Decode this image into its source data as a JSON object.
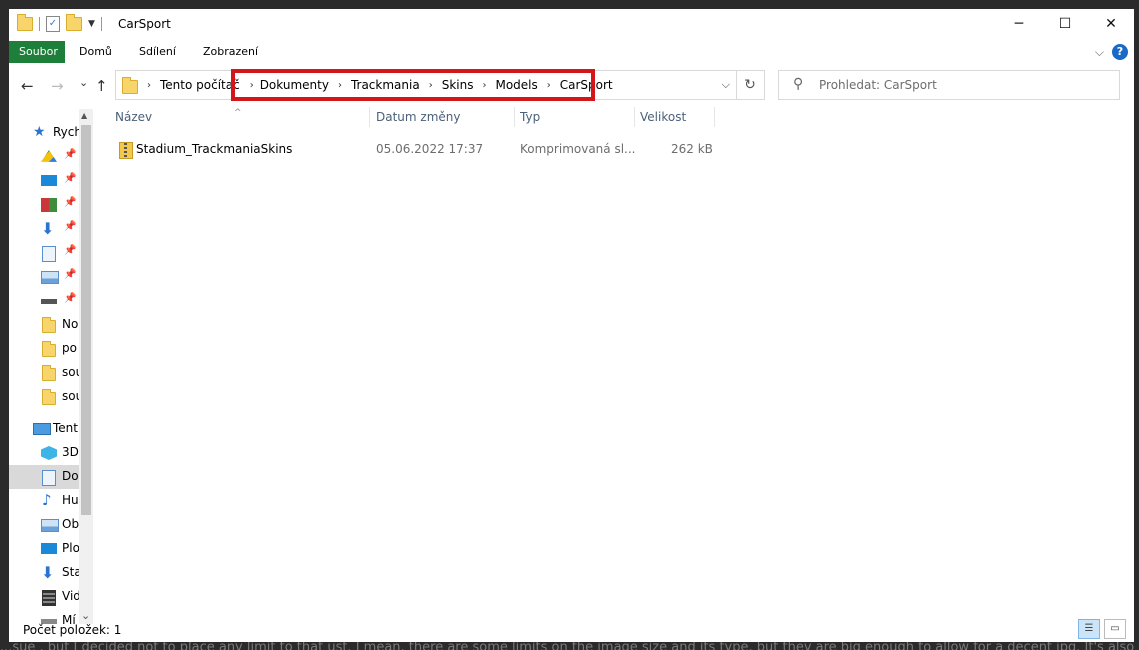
{
  "window": {
    "title": "CarSport",
    "minimize_glyph": "─",
    "maximize_glyph": "☐",
    "close_glyph": "✕"
  },
  "ribbon": {
    "tabs": [
      "Soubor",
      "Domů",
      "Sdílení",
      "Zobrazení"
    ],
    "expand_glyph": "⌵",
    "help_glyph": "?"
  },
  "address": {
    "path": [
      "Tento počítač",
      "Dokumenty",
      "Trackmania",
      "Skins",
      "Models",
      "CarSport"
    ],
    "separator_glyph": "›",
    "dropdown_glyph": "⌵",
    "refresh_glyph": "↻"
  },
  "nav": {
    "back_glyph": "←",
    "forward_glyph": "→",
    "recent_glyph": "⌄",
    "up_glyph": "↑"
  },
  "search": {
    "placeholder": "Prohledat: CarSport",
    "icon": "magnifier-icon",
    "glyph": "⚲"
  },
  "sidebar": {
    "items": [
      {
        "label": "Rych",
        "icon": "star-icon"
      },
      {
        "label": "",
        "icon": "drive-icon",
        "pinned": true
      },
      {
        "label": "",
        "icon": "desktop-icon",
        "pinned": true
      },
      {
        "label": "",
        "icon": "photos-icon",
        "pinned": true
      },
      {
        "label": "",
        "icon": "download-icon",
        "pinned": true
      },
      {
        "label": "",
        "icon": "document-icon",
        "pinned": true
      },
      {
        "label": "",
        "icon": "pictures-icon",
        "pinned": true
      },
      {
        "label": "",
        "icon": "drive-bar-icon",
        "pinned": true
      },
      {
        "label": "No",
        "icon": "folder-icon"
      },
      {
        "label": "po",
        "icon": "sync-folder-icon"
      },
      {
        "label": "sou",
        "icon": "sync-folder-icon"
      },
      {
        "label": "sou",
        "icon": "sync-folder-icon"
      },
      {
        "label": "Tent",
        "icon": "computer-icon"
      },
      {
        "label": "3D",
        "icon": "cube-icon"
      },
      {
        "label": "Do",
        "icon": "document-icon",
        "selected": true
      },
      {
        "label": "Hu",
        "icon": "music-icon"
      },
      {
        "label": "Ob",
        "icon": "pictures-icon"
      },
      {
        "label": "Plo",
        "icon": "desktop-icon"
      },
      {
        "label": "Sta",
        "icon": "download-icon"
      },
      {
        "label": "Vid",
        "icon": "video-icon"
      },
      {
        "label": "Mí",
        "icon": "drive-icon"
      }
    ],
    "pin_glyph": "📌",
    "scroll_up_glyph": "▲",
    "scroll_down_glyph": "⌄"
  },
  "columns": [
    "Název",
    "Datum změny",
    "Typ",
    "Velikost"
  ],
  "sort_glyph": "^",
  "files": [
    {
      "name": "Stadium_TrackmaniaSkins",
      "date": "05.06.2022 17:37",
      "type": "Komprimovaná sl...",
      "size": "262 kB",
      "icon": "zip-folder-icon"
    }
  ],
  "status": {
    "text": "Počet položek: 1"
  },
  "view_buttons": [
    {
      "name": "details-view",
      "glyph": "☰",
      "active": true
    },
    {
      "name": "large-icons-view",
      "glyph": "▭",
      "active": false
    }
  ],
  "background": {
    "bottom_text": "...sue , but I decided not to place any limit to that ust. I mean, there are some limits on the image size and its type, but they are big enough to allow for a decent jpg. It's also u"
  },
  "colors": {
    "file_tab": "#1e7f3a",
    "highlight": "#d4161a",
    "help": "#1b69c7"
  }
}
